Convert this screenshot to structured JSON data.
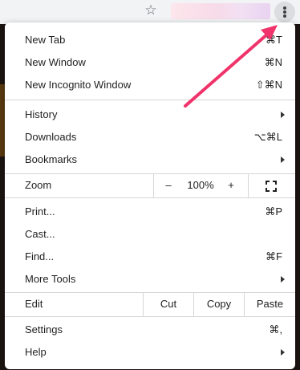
{
  "menu": {
    "group1": [
      {
        "label": "New Tab",
        "shortcut": "⌘T"
      },
      {
        "label": "New Window",
        "shortcut": "⌘N"
      },
      {
        "label": "New Incognito Window",
        "shortcut": "⇧⌘N"
      }
    ],
    "group2": [
      {
        "label": "History",
        "shortcut": ""
      },
      {
        "label": "Downloads",
        "shortcut": "⌥⌘L"
      },
      {
        "label": "Bookmarks",
        "shortcut": ""
      }
    ],
    "zoom": {
      "label": "Zoom",
      "minus": "–",
      "value": "100%",
      "plus": "+"
    },
    "group3": [
      {
        "label": "Print...",
        "shortcut": "⌘P"
      },
      {
        "label": "Cast...",
        "shortcut": ""
      },
      {
        "label": "Find...",
        "shortcut": "⌘F"
      },
      {
        "label": "More Tools",
        "shortcut": ""
      }
    ],
    "edit": {
      "label": "Edit",
      "cut": "Cut",
      "copy": "Copy",
      "paste": "Paste"
    },
    "group4": [
      {
        "label": "Settings",
        "shortcut": "⌘,"
      },
      {
        "label": "Help",
        "shortcut": ""
      }
    ]
  },
  "toolbar": {
    "star_icon": "☆",
    "menu_icon": "kebab-vertical",
    "accent_arrow_color": "#f0336a"
  }
}
